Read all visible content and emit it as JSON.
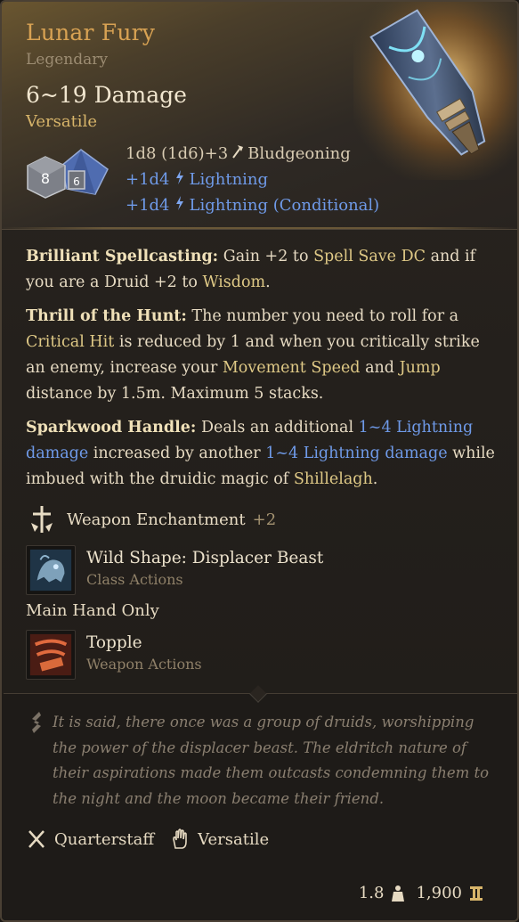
{
  "item": {
    "name": "Lunar Fury",
    "rarity": "Legendary",
    "damage": "6~19 Damage",
    "tag": "Versatile"
  },
  "damage_lines": {
    "base": {
      "dice": "1d8 (1d6)+3",
      "type": "Bludgeoning",
      "icon": "mace-icon"
    },
    "bonus1": {
      "dice": "+1d4",
      "type": "Lightning",
      "icon": "lightning-icon"
    },
    "bonus2": {
      "dice": "+1d4",
      "type": "Lightning (Conditional)",
      "icon": "lightning-icon"
    }
  },
  "dice_faces": {
    "d8": "8",
    "d6": "6"
  },
  "passives": [
    {
      "title": "Brilliant Spellcasting:",
      "t1": " Gain +2 to ",
      "h1": "Spell Save DC",
      "t2": " and if you are a Druid +2 to ",
      "h2": "Wisdom",
      "t3": "."
    },
    {
      "title": "Thrill of the Hunt:",
      "t1": " The number you need to roll for a ",
      "h1": "Critical Hit",
      "t2": " is reduced by 1 and when you critically strike an enemy, increase your ",
      "h2": "Movement Speed",
      "t3": " and ",
      "h3": "Jump",
      "t4": " distance by 1.5m. Maximum 5 stacks."
    },
    {
      "title": "Sparkwood Handle:",
      "t1": " Deals an additional ",
      "l1": "1~4 Lightning damage",
      "t2": " increased by another ",
      "l2": "1~4 Lightning damage",
      "t3": " while imbued with the druidic magic of ",
      "h1": "Shillelagh",
      "t4": "."
    }
  ],
  "enchantment": {
    "label": "Weapon Enchantment",
    "bonus": "+2",
    "icon": "sword-enchant-icon"
  },
  "actions": [
    {
      "title": "Wild Shape: Displacer Beast",
      "category": "Class Actions",
      "icon": "displacer-beast-icon"
    },
    {
      "title": "Topple",
      "category": "Weapon Actions",
      "icon": "topple-icon"
    }
  ],
  "main_hand_only": "Main Hand Only",
  "lore": "It is said, there once was a group of druids, worshipping the power of the displacer beast. The eldritch nature of their aspirations made them outcasts condemning them to the night and the moon became their friend.",
  "properties": [
    {
      "label": "Quarterstaff",
      "icon": "crossed-staffs-icon"
    },
    {
      "label": "Versatile",
      "icon": "hand-icon"
    }
  ],
  "stats": {
    "weight": "1.8",
    "value": "1,900",
    "weight_icon": "weight-icon",
    "value_icon": "gold-coin-icon"
  },
  "colors": {
    "name": "#d8a253",
    "lightning": "#6f9ae8",
    "highlight": "#dfc986"
  }
}
